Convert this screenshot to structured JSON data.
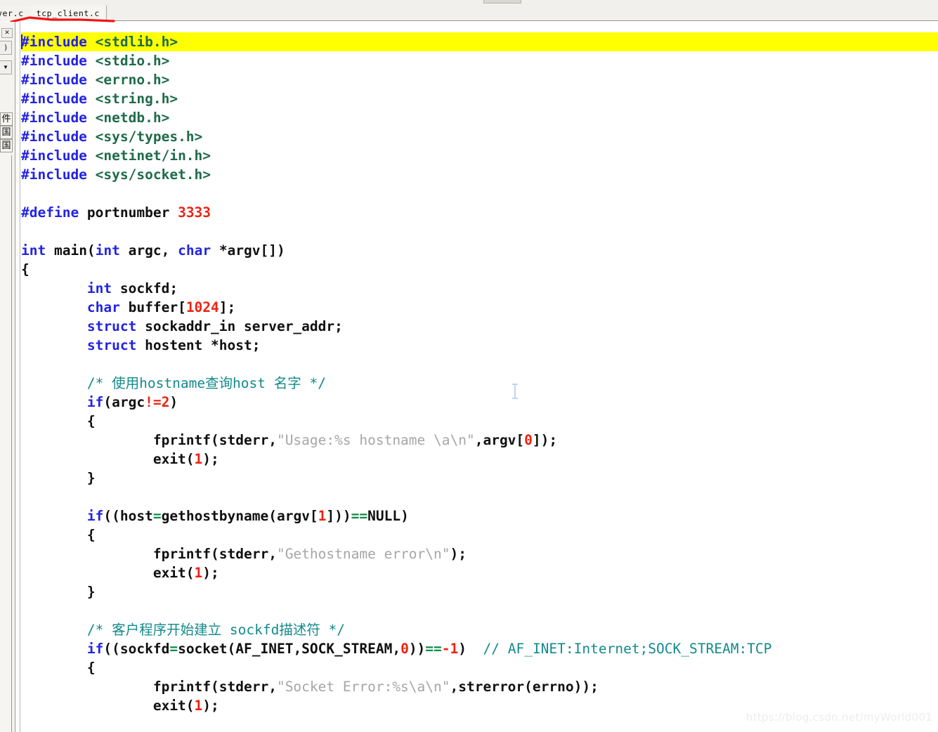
{
  "window": {
    "active_file": "tcp_client.c"
  },
  "tabbar": {
    "tabs": [
      {
        "label": "ver.c",
        "truncated": true,
        "active": false
      },
      {
        "label": "tcp_client.c",
        "truncated": false,
        "active": true
      }
    ]
  },
  "left_panel": {
    "close_label": "✕",
    "round_icon_label": ")",
    "dropdown_label": "▼",
    "vertical_labels": [
      "件",
      "国",
      "国"
    ]
  },
  "editor": {
    "highlighted_line_index": 0,
    "lines": [
      {
        "highlight": true,
        "tokens": [
          {
            "t": "cursor"
          },
          {
            "t": "kw",
            "v": "#include"
          },
          {
            "t": "pl",
            "v": " "
          },
          {
            "t": "ang",
            "v": "<stdlib.h>"
          }
        ]
      },
      {
        "highlight": false,
        "tokens": [
          {
            "t": "kw",
            "v": "#include"
          },
          {
            "t": "pl",
            "v": " "
          },
          {
            "t": "ang",
            "v": "<stdio.h>"
          }
        ]
      },
      {
        "highlight": false,
        "tokens": [
          {
            "t": "kw",
            "v": "#include"
          },
          {
            "t": "pl",
            "v": " "
          },
          {
            "t": "ang",
            "v": "<errno.h>"
          }
        ]
      },
      {
        "highlight": false,
        "tokens": [
          {
            "t": "kw",
            "v": "#include"
          },
          {
            "t": "pl",
            "v": " "
          },
          {
            "t": "ang",
            "v": "<string.h>"
          }
        ]
      },
      {
        "highlight": false,
        "tokens": [
          {
            "t": "kw",
            "v": "#include"
          },
          {
            "t": "pl",
            "v": " "
          },
          {
            "t": "ang",
            "v": "<netdb.h>"
          }
        ]
      },
      {
        "highlight": false,
        "tokens": [
          {
            "t": "kw",
            "v": "#include"
          },
          {
            "t": "pl",
            "v": " "
          },
          {
            "t": "ang",
            "v": "<sys/types.h>"
          }
        ]
      },
      {
        "highlight": false,
        "tokens": [
          {
            "t": "kw",
            "v": "#include"
          },
          {
            "t": "pl",
            "v": " "
          },
          {
            "t": "ang",
            "v": "<netinet/in.h>"
          }
        ]
      },
      {
        "highlight": false,
        "tokens": [
          {
            "t": "kw",
            "v": "#include"
          },
          {
            "t": "pl",
            "v": " "
          },
          {
            "t": "ang",
            "v": "<sys/socket.h>"
          }
        ]
      },
      {
        "highlight": false,
        "tokens": []
      },
      {
        "highlight": false,
        "tokens": [
          {
            "t": "kw",
            "v": "#define"
          },
          {
            "t": "pl",
            "v": " portnumber "
          },
          {
            "t": "num",
            "v": "3333"
          }
        ]
      },
      {
        "highlight": false,
        "tokens": []
      },
      {
        "highlight": false,
        "tokens": [
          {
            "t": "kw",
            "v": "int"
          },
          {
            "t": "pl",
            "v": " main("
          },
          {
            "t": "kw",
            "v": "int"
          },
          {
            "t": "pl",
            "v": " argc, "
          },
          {
            "t": "kw",
            "v": "char"
          },
          {
            "t": "pl",
            "v": " *argv[])"
          }
        ]
      },
      {
        "highlight": false,
        "tokens": [
          {
            "t": "pl",
            "v": "{"
          }
        ]
      },
      {
        "highlight": false,
        "tokens": [
          {
            "t": "pl",
            "v": "        "
          },
          {
            "t": "kw",
            "v": "int"
          },
          {
            "t": "pl",
            "v": " sockfd;"
          }
        ]
      },
      {
        "highlight": false,
        "tokens": [
          {
            "t": "pl",
            "v": "        "
          },
          {
            "t": "kw",
            "v": "char"
          },
          {
            "t": "pl",
            "v": " buffer["
          },
          {
            "t": "num",
            "v": "1024"
          },
          {
            "t": "pl",
            "v": "];"
          }
        ]
      },
      {
        "highlight": false,
        "tokens": [
          {
            "t": "pl",
            "v": "        "
          },
          {
            "t": "kw",
            "v": "struct"
          },
          {
            "t": "pl",
            "v": " sockaddr_in server_addr;"
          }
        ]
      },
      {
        "highlight": false,
        "tokens": [
          {
            "t": "pl",
            "v": "        "
          },
          {
            "t": "kw",
            "v": "struct"
          },
          {
            "t": "pl",
            "v": " hostent *host;"
          }
        ]
      },
      {
        "highlight": false,
        "tokens": []
      },
      {
        "highlight": false,
        "tokens": [
          {
            "t": "pl",
            "v": "        "
          },
          {
            "t": "cmt",
            "v": "/* 使用hostname查询host 名字 */"
          }
        ]
      },
      {
        "highlight": false,
        "tokens": [
          {
            "t": "pl",
            "v": "        "
          },
          {
            "t": "kw",
            "v": "if"
          },
          {
            "t": "pl",
            "v": "(argc"
          },
          {
            "t": "num",
            "v": "!="
          },
          {
            "t": "num",
            "v": "2"
          },
          {
            "t": "pl",
            "v": ")"
          }
        ]
      },
      {
        "highlight": false,
        "tokens": [
          {
            "t": "pl",
            "v": "        {"
          }
        ]
      },
      {
        "highlight": false,
        "tokens": [
          {
            "t": "pl",
            "v": "                fprintf(stderr,"
          },
          {
            "t": "str",
            "v": "\"Usage:%s hostname \\a\\n\""
          },
          {
            "t": "pl",
            "v": ",argv["
          },
          {
            "t": "num",
            "v": "0"
          },
          {
            "t": "pl",
            "v": "]);"
          }
        ]
      },
      {
        "highlight": false,
        "tokens": [
          {
            "t": "pl",
            "v": "                exit("
          },
          {
            "t": "num",
            "v": "1"
          },
          {
            "t": "pl",
            "v": ");"
          }
        ]
      },
      {
        "highlight": false,
        "tokens": [
          {
            "t": "pl",
            "v": "        }"
          }
        ]
      },
      {
        "highlight": false,
        "tokens": []
      },
      {
        "highlight": false,
        "tokens": [
          {
            "t": "pl",
            "v": "        "
          },
          {
            "t": "kw",
            "v": "if"
          },
          {
            "t": "pl",
            "v": "((host"
          },
          {
            "t": "op",
            "v": "="
          },
          {
            "t": "pl",
            "v": "gethostbyname(argv["
          },
          {
            "t": "num",
            "v": "1"
          },
          {
            "t": "pl",
            "v": "]))"
          },
          {
            "t": "op",
            "v": "=="
          },
          {
            "t": "pl",
            "v": "NULL)"
          }
        ]
      },
      {
        "highlight": false,
        "tokens": [
          {
            "t": "pl",
            "v": "        {"
          }
        ]
      },
      {
        "highlight": false,
        "tokens": [
          {
            "t": "pl",
            "v": "                fprintf(stderr,"
          },
          {
            "t": "str",
            "v": "\"Gethostname error\\n\""
          },
          {
            "t": "pl",
            "v": ");"
          }
        ]
      },
      {
        "highlight": false,
        "tokens": [
          {
            "t": "pl",
            "v": "                exit("
          },
          {
            "t": "num",
            "v": "1"
          },
          {
            "t": "pl",
            "v": ");"
          }
        ]
      },
      {
        "highlight": false,
        "tokens": [
          {
            "t": "pl",
            "v": "        }"
          }
        ]
      },
      {
        "highlight": false,
        "tokens": []
      },
      {
        "highlight": false,
        "tokens": [
          {
            "t": "pl",
            "v": "        "
          },
          {
            "t": "cmt",
            "v": "/* 客户程序开始建立 sockfd描述符 */"
          }
        ]
      },
      {
        "highlight": false,
        "tokens": [
          {
            "t": "pl",
            "v": "        "
          },
          {
            "t": "kw",
            "v": "if"
          },
          {
            "t": "pl",
            "v": "((sockfd"
          },
          {
            "t": "op",
            "v": "="
          },
          {
            "t": "pl",
            "v": "socket(AF_INET,SOCK_STREAM,"
          },
          {
            "t": "num",
            "v": "0"
          },
          {
            "t": "pl",
            "v": "))"
          },
          {
            "t": "op",
            "v": "=="
          },
          {
            "t": "num",
            "v": "-1"
          },
          {
            "t": "pl",
            "v": ")  "
          },
          {
            "t": "cmt",
            "v": "// AF_INET:Internet;SOCK_STREAM:TCP"
          }
        ]
      },
      {
        "highlight": false,
        "tokens": [
          {
            "t": "pl",
            "v": "        {"
          }
        ]
      },
      {
        "highlight": false,
        "tokens": [
          {
            "t": "pl",
            "v": "                fprintf(stderr,"
          },
          {
            "t": "str",
            "v": "\"Socket Error:%s\\a\\n\""
          },
          {
            "t": "pl",
            "v": ",strerror(errno));"
          }
        ]
      },
      {
        "highlight": false,
        "tokens": [
          {
            "t": "pl",
            "v": "                exit("
          },
          {
            "t": "num",
            "v": "1"
          },
          {
            "t": "pl",
            "v": ");"
          }
        ]
      }
    ]
  },
  "watermark": {
    "text": "https://blog.csdn.net/myWorld001"
  },
  "colors": {
    "keyword": "#2323e6",
    "number": "#ee2211",
    "string": "#a6a6a6",
    "comment": "#138a8a",
    "include_brackets": "#1f6b4a",
    "operator": "#0f8a4a",
    "highlight_line": "#ffff00",
    "annotation": "#f41414"
  }
}
